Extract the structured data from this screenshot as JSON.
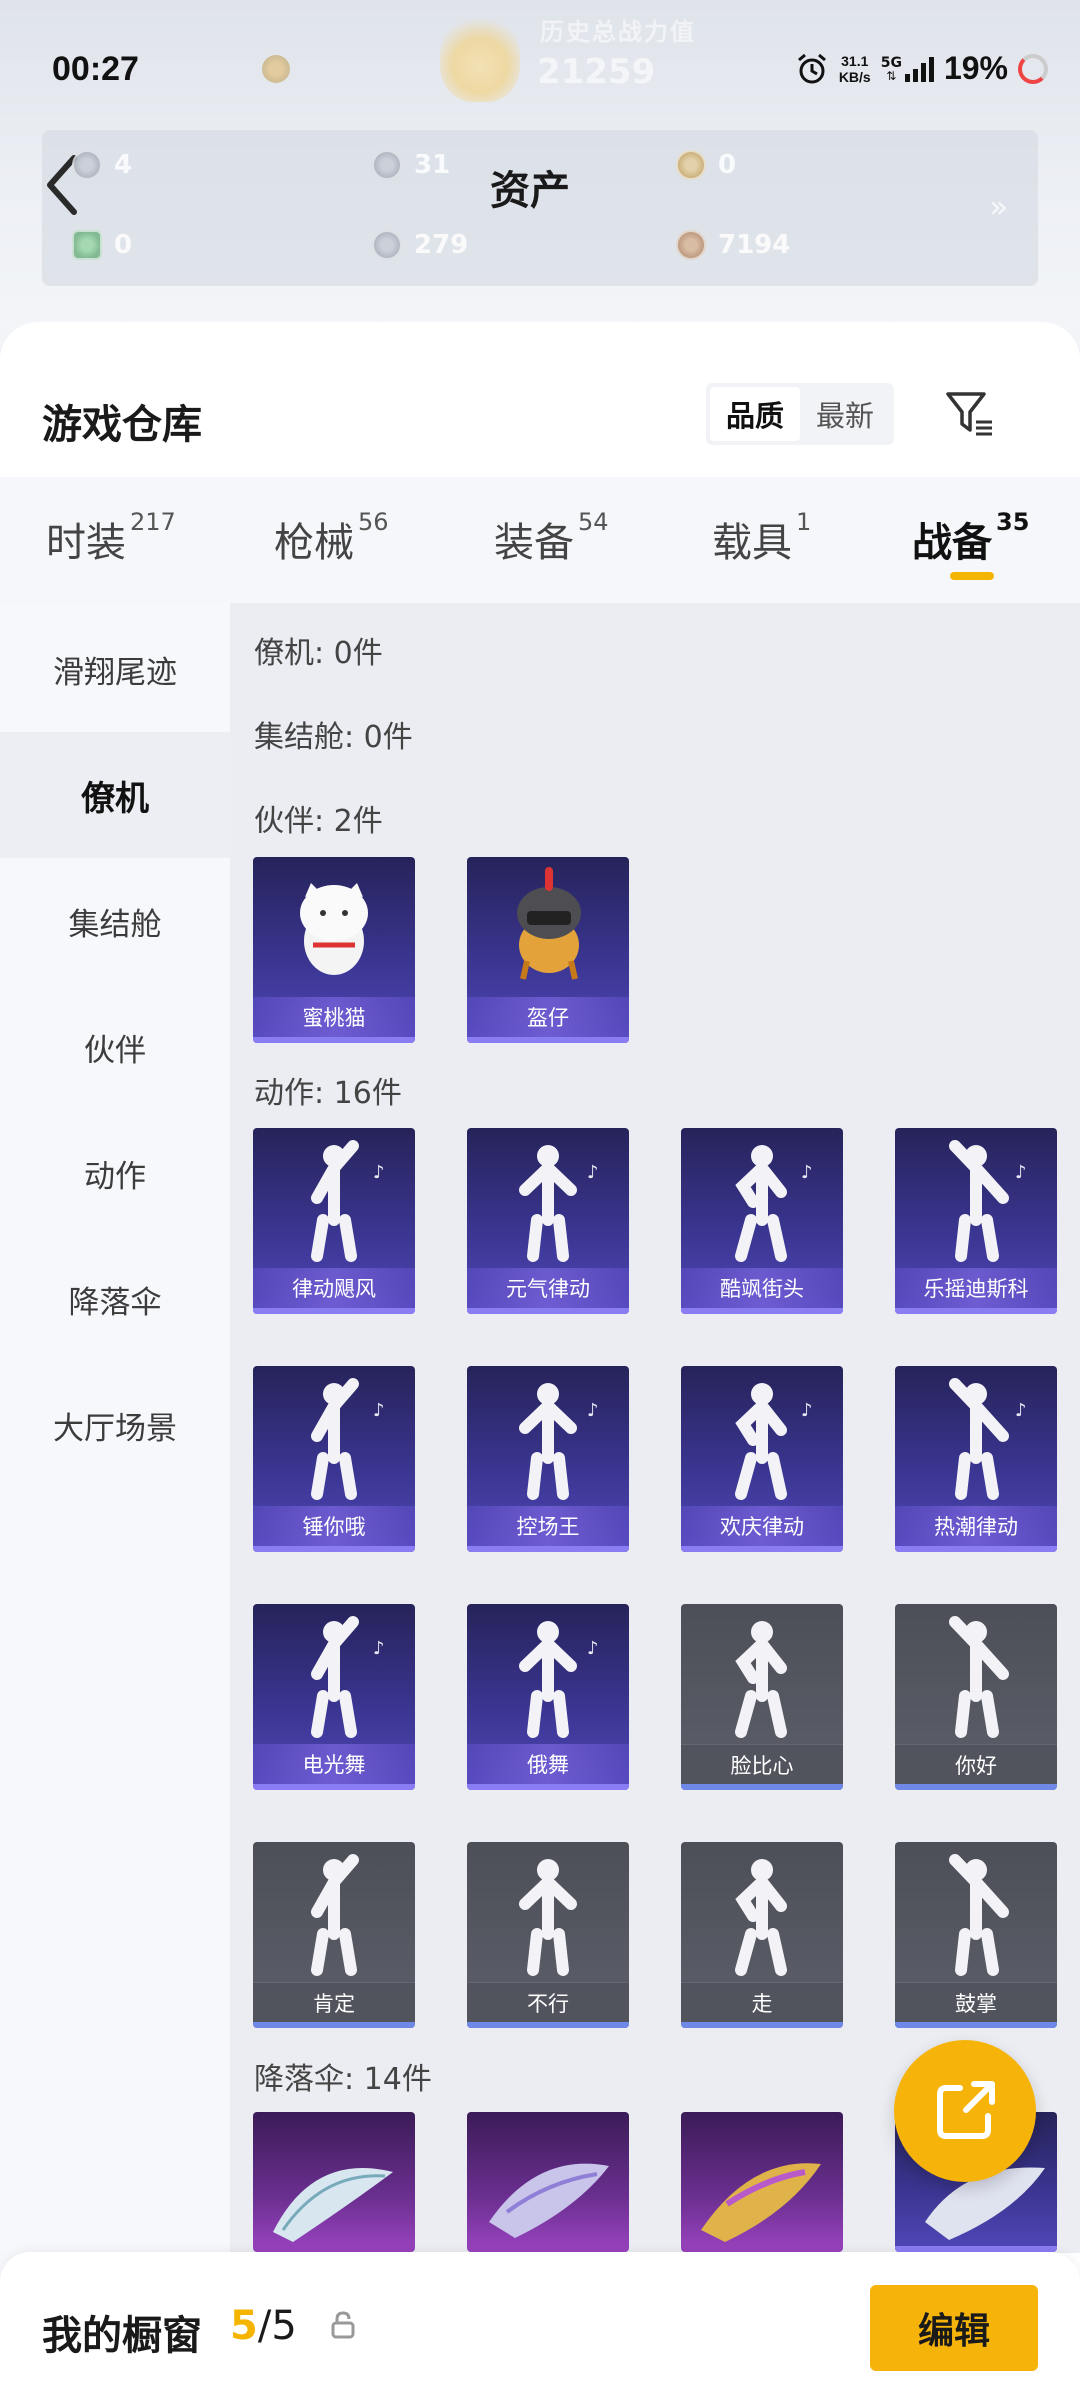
{
  "status_bar": {
    "time": "00:27",
    "net_speed_value": "31.1",
    "net_speed_unit": "KB/s",
    "network": "5G",
    "battery": "19%"
  },
  "header": {
    "faint_title": "历史总战力值",
    "faint_score": "21259"
  },
  "assets": {
    "title": "资产",
    "items": [
      {
        "icon": "silver-gem-icon",
        "value": "4"
      },
      {
        "icon": "silver-coin-icon",
        "value": "31"
      },
      {
        "icon": "gold-coin-icon",
        "value": "0"
      },
      {
        "icon": "green-ticket-icon",
        "value": "0"
      },
      {
        "icon": "silver-token-icon",
        "value": "279"
      },
      {
        "icon": "bronze-coin-icon",
        "value": "7194"
      }
    ]
  },
  "warehouse": {
    "title": "游戏仓库",
    "sort_options": [
      "品质",
      "最新"
    ],
    "active_sort": "品质"
  },
  "tabs": [
    {
      "label": "时装",
      "count": "217"
    },
    {
      "label": "枪械",
      "count": "56"
    },
    {
      "label": "装备",
      "count": "54"
    },
    {
      "label": "载具",
      "count": "1"
    },
    {
      "label": "战备",
      "count": "35"
    }
  ],
  "active_tab": "战备",
  "sidebar": [
    "滑翔尾迹",
    "僚机",
    "集结舱",
    "伙伴",
    "动作",
    "降落伞",
    "大厅场景"
  ],
  "active_side": "僚机",
  "sections": {
    "wingman": "僚机: 0件",
    "pod": "集结舱: 0件",
    "partner": "伙伴: 2件",
    "action": "动作: 16件",
    "parachute": "降落伞: 14件"
  },
  "partners": [
    "蜜桃猫",
    "盔仔"
  ],
  "actions": [
    "律动飓风",
    "元气律动",
    "酷飒街头",
    "乐摇迪斯科",
    "锤你哦",
    "控场王",
    "欢庆律动",
    "热潮律动",
    "电光舞",
    "俄舞",
    "脸比心",
    "你好",
    "肯定",
    "不行",
    "走",
    "鼓掌"
  ],
  "bottom": {
    "label": "我的橱窗",
    "current": "5",
    "total": "/5",
    "edit_label": "编辑"
  },
  "colors": {
    "accent": "#f5b400",
    "tile_purple": "#3a3590",
    "tile_gray": "#5c5f69",
    "tile_parachute": "#6a2f8f"
  }
}
